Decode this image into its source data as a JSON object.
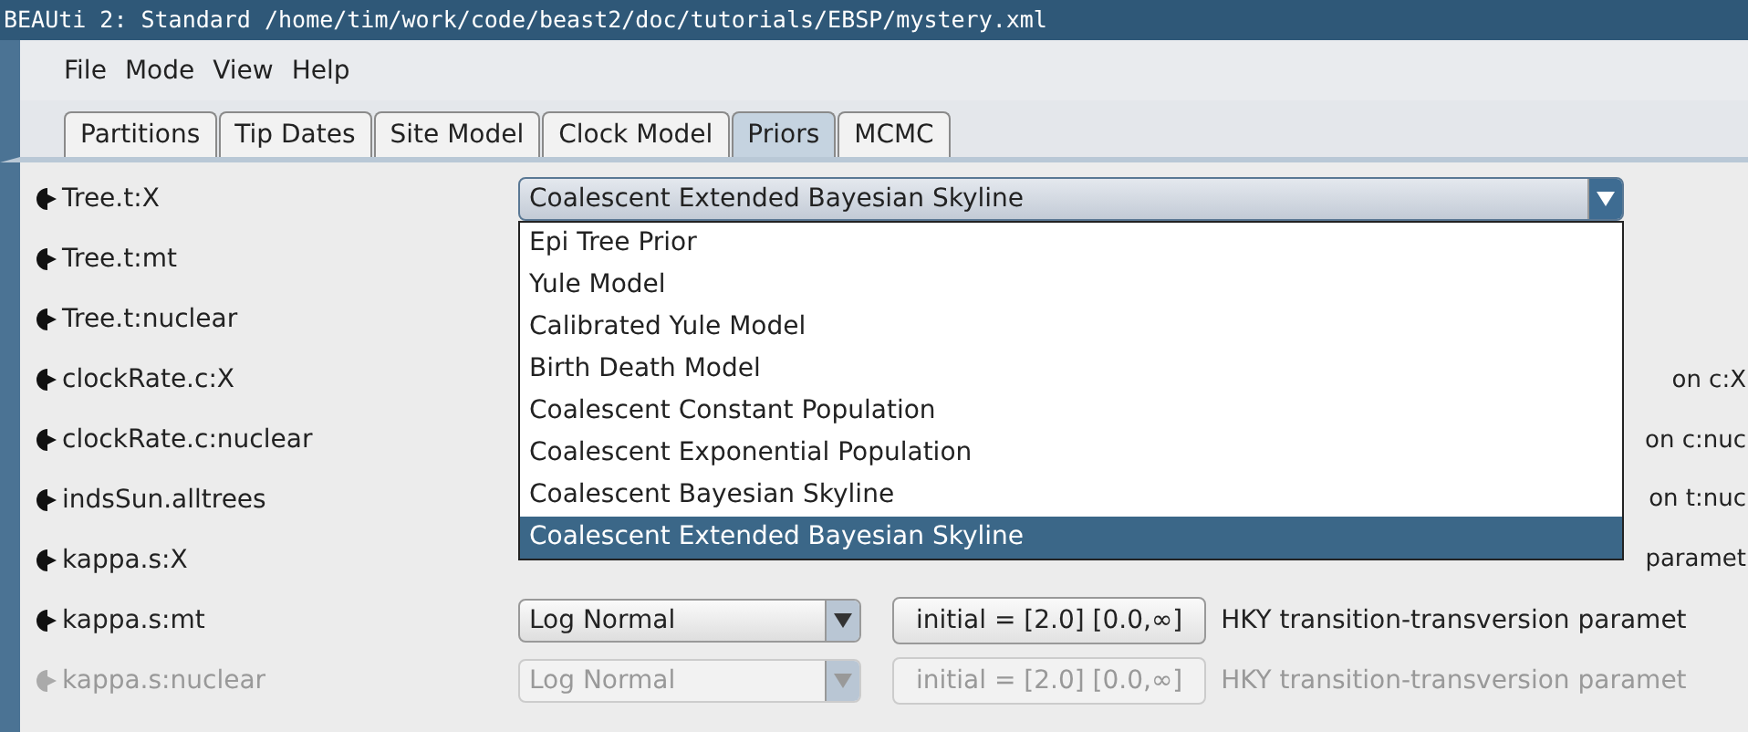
{
  "window": {
    "title": "BEAUti 2: Standard /home/tim/work/code/beast2/doc/tutorials/EBSP/mystery.xml"
  },
  "menu": [
    "File",
    "Mode",
    "View",
    "Help"
  ],
  "tabs": [
    {
      "label": "Partitions",
      "selected": false
    },
    {
      "label": "Tip Dates",
      "selected": false
    },
    {
      "label": "Site Model",
      "selected": false
    },
    {
      "label": "Clock Model",
      "selected": false
    },
    {
      "label": "Priors",
      "selected": true
    },
    {
      "label": "MCMC",
      "selected": false
    }
  ],
  "rows": [
    {
      "label": "Tree.t:X",
      "disabled": false,
      "prior": {
        "kind": "wide",
        "value": "Coalescent Extended Bayesian Skyline",
        "expanded": true,
        "options": [
          {
            "label": "Epi Tree Prior",
            "selected": false
          },
          {
            "label": "Yule Model",
            "selected": false
          },
          {
            "label": "Calibrated Yule Model",
            "selected": false
          },
          {
            "label": "Birth Death Model",
            "selected": false
          },
          {
            "label": "Coalescent Constant Population",
            "selected": false
          },
          {
            "label": "Coalescent Exponential Population",
            "selected": false
          },
          {
            "label": "Coalescent Bayesian Skyline",
            "selected": false
          },
          {
            "label": "Coalescent Extended Bayesian Skyline",
            "selected": true
          }
        ]
      }
    },
    {
      "label": "Tree.t:mt",
      "disabled": false
    },
    {
      "label": "Tree.t:nuclear",
      "disabled": false
    },
    {
      "label": "clockRate.c:X",
      "disabled": false,
      "description": "on c:X"
    },
    {
      "label": "clockRate.c:nuclear",
      "disabled": false,
      "description": "on c:nuc"
    },
    {
      "label": "indsSun.alltrees",
      "disabled": false,
      "description": "on t:nuc"
    },
    {
      "label": "kappa.s:X",
      "disabled": false,
      "description": "paramet"
    },
    {
      "label": "kappa.s:mt",
      "disabled": false,
      "prior": {
        "kind": "narrow",
        "value": "Log Normal",
        "expanded": false
      },
      "initial": "initial = [2.0]  [0.0,∞]",
      "description": "HKY transition-transversion paramet"
    },
    {
      "label": "kappa.s:nuclear",
      "disabled": true,
      "prior": {
        "kind": "narrow",
        "value": "Log Normal",
        "expanded": false
      },
      "initial": "initial = [2.0]  [0.0,∞]",
      "description": "HKY transition-transversion paramet"
    }
  ]
}
